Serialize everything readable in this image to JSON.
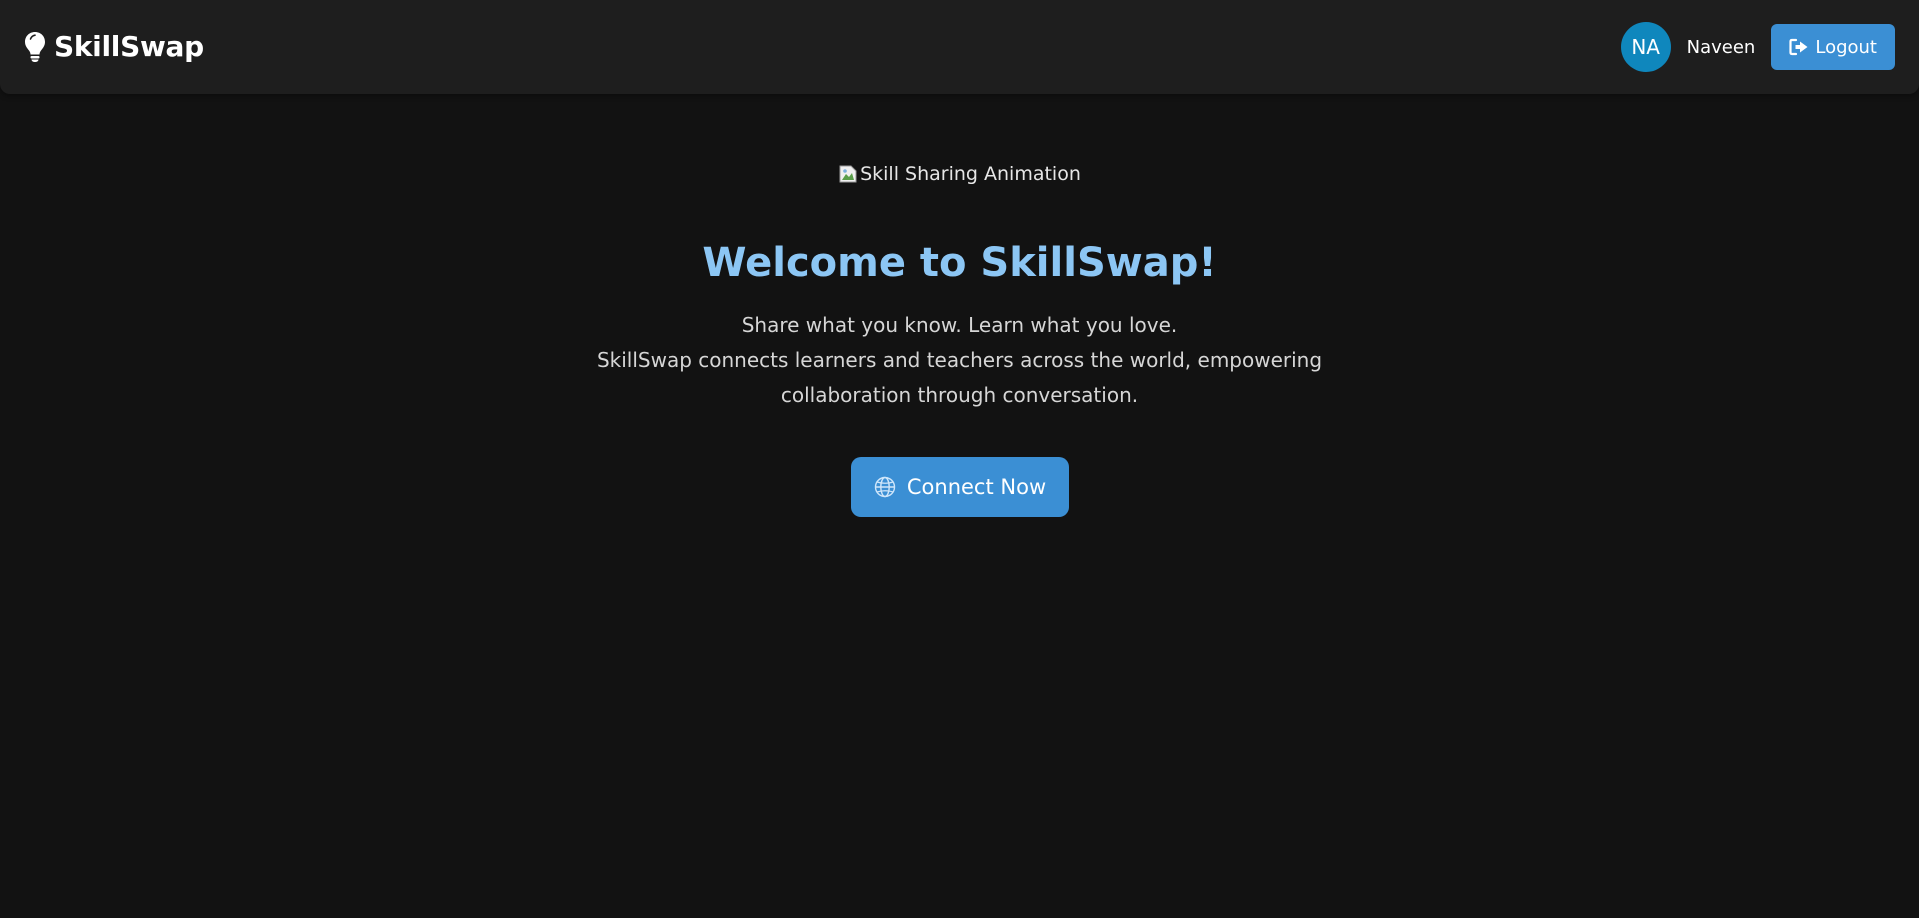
{
  "navbar": {
    "brand_icon": "lightbulb-icon",
    "brand_name": "SkillSwap",
    "user": {
      "initials": "NA",
      "name": "Naveen",
      "avatar_color": "#0f87bd"
    },
    "logout": {
      "icon": "sign-out-icon",
      "label": "Logout"
    }
  },
  "hero": {
    "image_alt": "Skill Sharing Animation",
    "title": "Welcome to SkillSwap!",
    "tagline": "Share what you know. Learn what you love.",
    "description_line1": "SkillSwap connects learners and teachers across the world, empowering",
    "description_line2": "collaboration through conversation.",
    "cta": {
      "icon": "globe-icon",
      "label": "Connect Now"
    }
  },
  "colors": {
    "background": "#121212",
    "navbar": "#1e1e1e",
    "accent": "#3b8fd4",
    "title": "#8cc6f4"
  }
}
